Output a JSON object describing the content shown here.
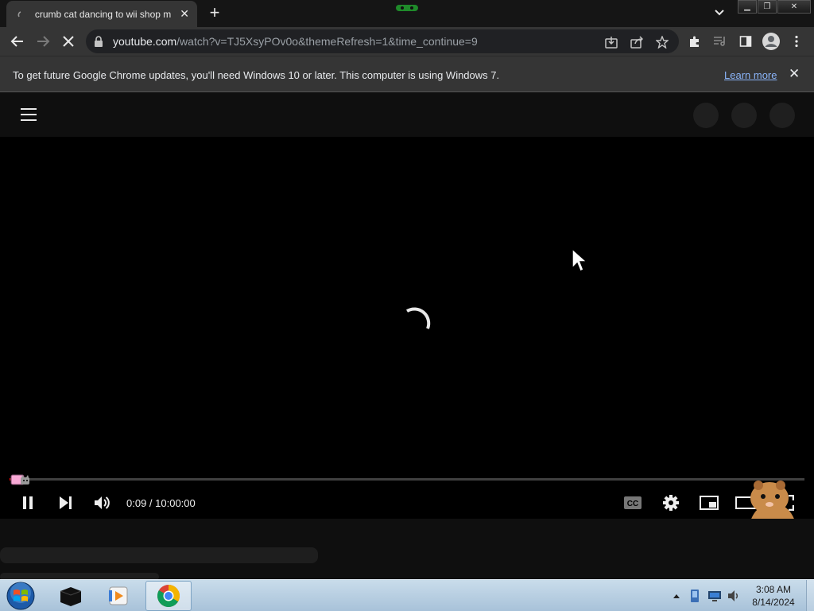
{
  "browser": {
    "tab": {
      "title": "crumb cat dancing to wii shop m"
    },
    "omnibox": {
      "host": "youtube.com",
      "path": "/watch?v=TJ5XsyPOv0o&themeRefresh=1&time_continue=9"
    },
    "infobar": {
      "message": "To get future Google Chrome updates, you'll need Windows 10 or later. This computer is using Windows 7.",
      "link": "Learn more"
    }
  },
  "player": {
    "time_display": "0:09 / 10:00:00",
    "progress_fraction": 0.00025
  },
  "taskbar": {
    "clock_time": "3:08 AM",
    "clock_date": "8/14/2024"
  },
  "colors": {
    "progress": "#ff0000",
    "link": "#8ab4f8"
  }
}
